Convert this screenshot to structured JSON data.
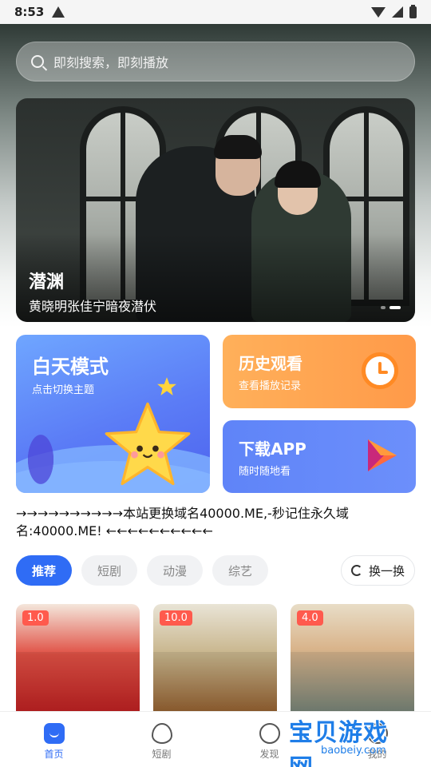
{
  "status_bar": {
    "time": "8:53"
  },
  "search": {
    "placeholder": "即刻搜索，即刻播放"
  },
  "banner": {
    "title": "潜渊",
    "subtitle": "黄晓明张佳宁暗夜潜伏",
    "dot_count": 2,
    "active_dot": 1
  },
  "cards": {
    "day_mode": {
      "title": "白天模式",
      "desc": "点击切换主题"
    },
    "history": {
      "title": "历史观看",
      "desc": "查看播放记录"
    },
    "download": {
      "title": "下载APP",
      "desc": "随时随地看"
    }
  },
  "notice": "→→→→→→→→→→本站更换域名40000.ME,-秒记住永久域名:40000.ME! ←←←←←←←←←←",
  "tabs": [
    {
      "label": "推荐",
      "active": true
    },
    {
      "label": "短剧",
      "active": false
    },
    {
      "label": "动漫",
      "active": false
    },
    {
      "label": "综艺",
      "active": false
    }
  ],
  "refresh": {
    "label": "换一换"
  },
  "posters": [
    {
      "rating": "1.0"
    },
    {
      "rating": "10.0"
    },
    {
      "rating": "4.0"
    }
  ],
  "bottom_nav": [
    {
      "label": "首页",
      "icon": "home-icon",
      "active": true
    },
    {
      "label": "短剧",
      "icon": "fire-icon",
      "active": false
    },
    {
      "label": "发现",
      "icon": "planet-icon",
      "active": false
    },
    {
      "label": "我的",
      "icon": "user-icon",
      "active": false
    }
  ],
  "watermark": {
    "title": "宝贝游戏网",
    "url": "baobeiy.com"
  },
  "colors": {
    "accent": "#2f6cf5",
    "history_card": "#ff9a49",
    "download_card": "#5f84f8",
    "rating_badge": "#ff5a4d"
  }
}
